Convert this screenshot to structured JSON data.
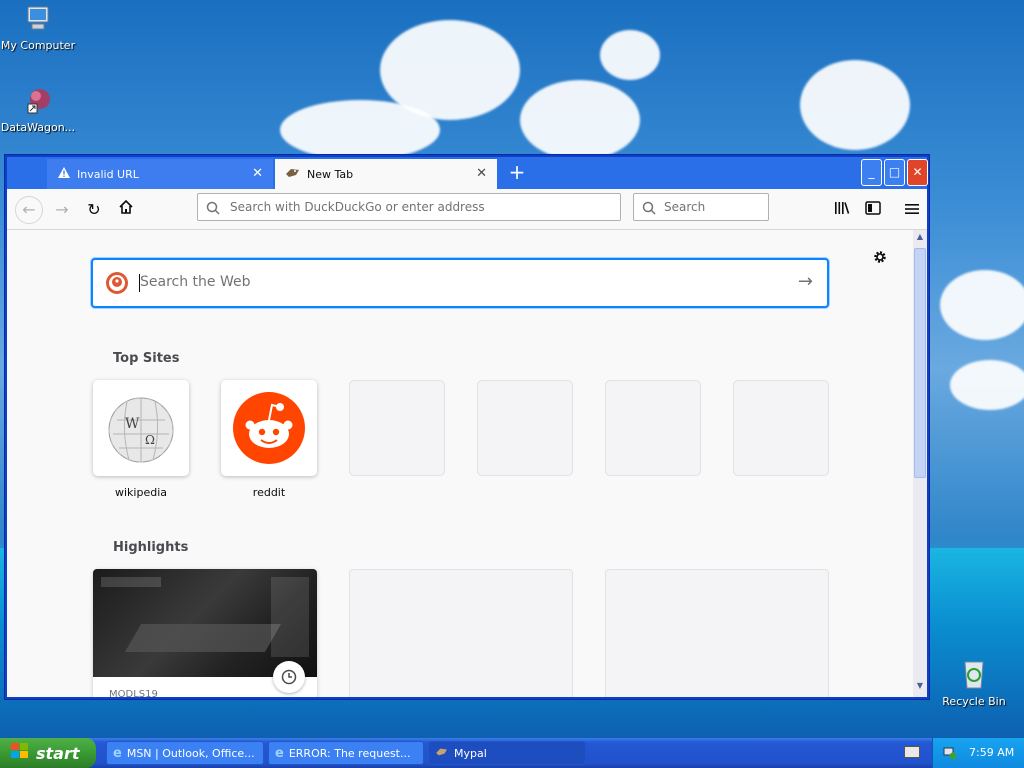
{
  "desktop": {
    "icons": [
      {
        "label": "My Computer"
      },
      {
        "label": "DataWagon..."
      },
      {
        "label": "Recycle Bin"
      }
    ]
  },
  "browser": {
    "tabs": [
      {
        "label": "Invalid URL",
        "icon": "warning-icon",
        "active": false
      },
      {
        "label": "New Tab",
        "icon": "mypal-icon",
        "active": true
      }
    ],
    "new_tab_symbol": "+",
    "close_symbol": "✕",
    "window_buttons": {
      "minimize": "_",
      "maximize": "□",
      "close": "✕"
    },
    "address_placeholder": "Search with DuckDuckGo or enter address",
    "search_placeholder": "Search",
    "web_search_placeholder": "Search the Web",
    "top_sites_heading": "Top Sites",
    "top_sites": [
      {
        "label": "wikipedia",
        "icon": "wikipedia-globe-icon"
      },
      {
        "label": "reddit",
        "icon": "reddit-icon"
      }
    ],
    "highlights_heading": "Highlights",
    "highlights": [
      {
        "label": "MODLS19"
      }
    ]
  },
  "taskbar": {
    "start_label": "start",
    "tasks": [
      {
        "label": "MSN | Outlook, Office...",
        "icon": "ie-icon",
        "active": false
      },
      {
        "label": "ERROR: The request...",
        "icon": "ie-icon",
        "active": false
      },
      {
        "label": "Mypal",
        "icon": "mypal-icon",
        "active": true
      }
    ],
    "clock": "7:59 AM"
  },
  "colors": {
    "accent": "#0a84ff",
    "reddit": "#ff4500",
    "xp_blue": "#0b3fd0",
    "start_green": "#3a9a33"
  }
}
